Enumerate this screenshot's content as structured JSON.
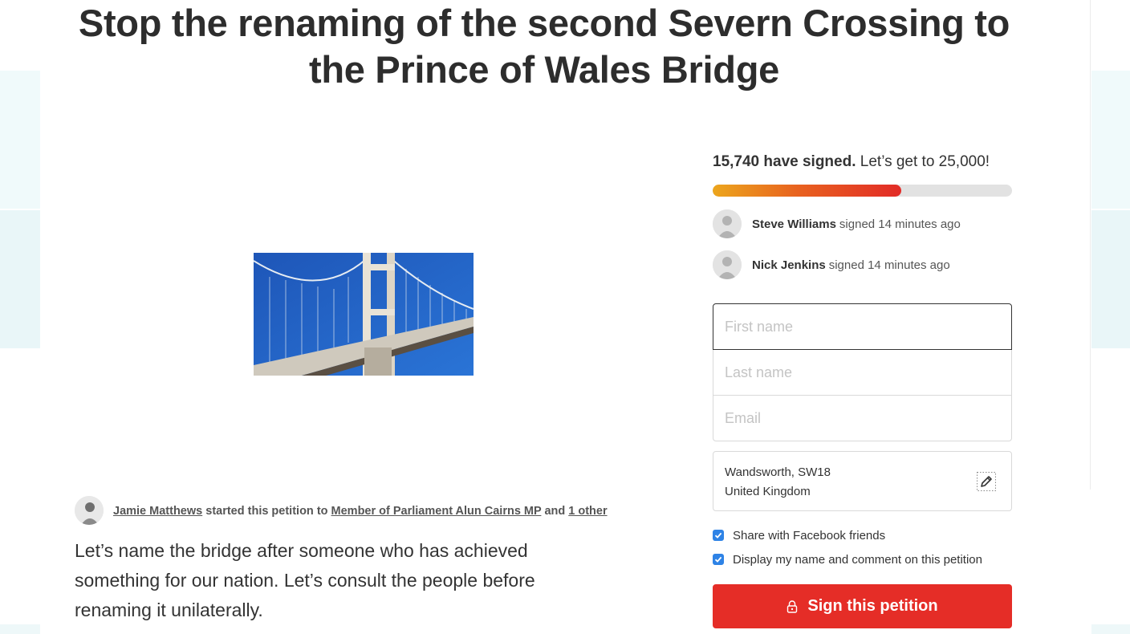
{
  "petition": {
    "title": "Stop the renaming of the second Severn Crossing to the Prince of Wales Bridge",
    "starter": {
      "name": "Jamie Matthews",
      "started_text": "started this petition to",
      "target": "Member of Parliament Alun Cairns MP",
      "and_text": "and",
      "others": "1 other"
    },
    "description": "Let’s name the bridge after someone who has achieved something for our nation. Let’s consult the people before renaming it unilaterally."
  },
  "signatures": {
    "count_text": "15,740 have signed.",
    "goal_text": "Let’s get to 25,000!",
    "progress_fraction": 0.6296
  },
  "recent_signers": [
    {
      "name": "Steve Williams",
      "time_text": "signed 14 minutes ago"
    },
    {
      "name": "Nick Jenkins",
      "time_text": "signed 14 minutes ago"
    }
  ],
  "form": {
    "first_name_placeholder": "First name",
    "last_name_placeholder": "Last name",
    "email_placeholder": "Email",
    "location_line1": "Wandsworth, SW18",
    "location_line2": "United Kingdom",
    "share_facebook_label": "Share with Facebook friends",
    "display_name_label": "Display my name and comment on this petition",
    "share_facebook_checked": true,
    "display_name_checked": true,
    "sign_button_label": "Sign this petition"
  },
  "colors": {
    "accent": "#e52d27",
    "checkbox": "#2e83e6",
    "progress_start": "#eca61d",
    "progress_end": "#e22b27"
  },
  "icons": [
    "lock-icon",
    "edit-pencil-icon",
    "check-icon",
    "user-avatar-icon"
  ]
}
